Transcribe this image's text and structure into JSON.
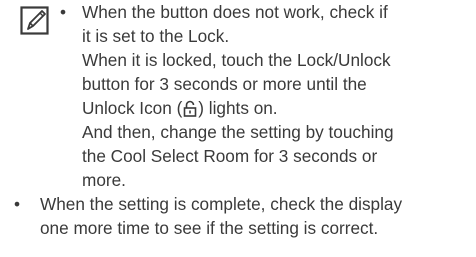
{
  "note": {
    "icon": "note-pencil-icon",
    "bullet": "•",
    "lines": [
      "When the button does not work, check if",
      "it is set to the Lock.",
      "When it is locked, touch the Lock/Unlock",
      "button for 3 seconds or more until the"
    ],
    "unlock_prefix": "Unlock Icon (",
    "unlock_icon": "unlock-icon",
    "unlock_suffix": ") lights on.",
    "lines_after": [
      "And then, change the setting by touching",
      "the Cool Select Room for 3 seconds or",
      "more."
    ]
  },
  "main": {
    "bullet": "•",
    "lines": [
      "When the setting is complete, check the display",
      "one more time to see if the setting is correct."
    ]
  }
}
